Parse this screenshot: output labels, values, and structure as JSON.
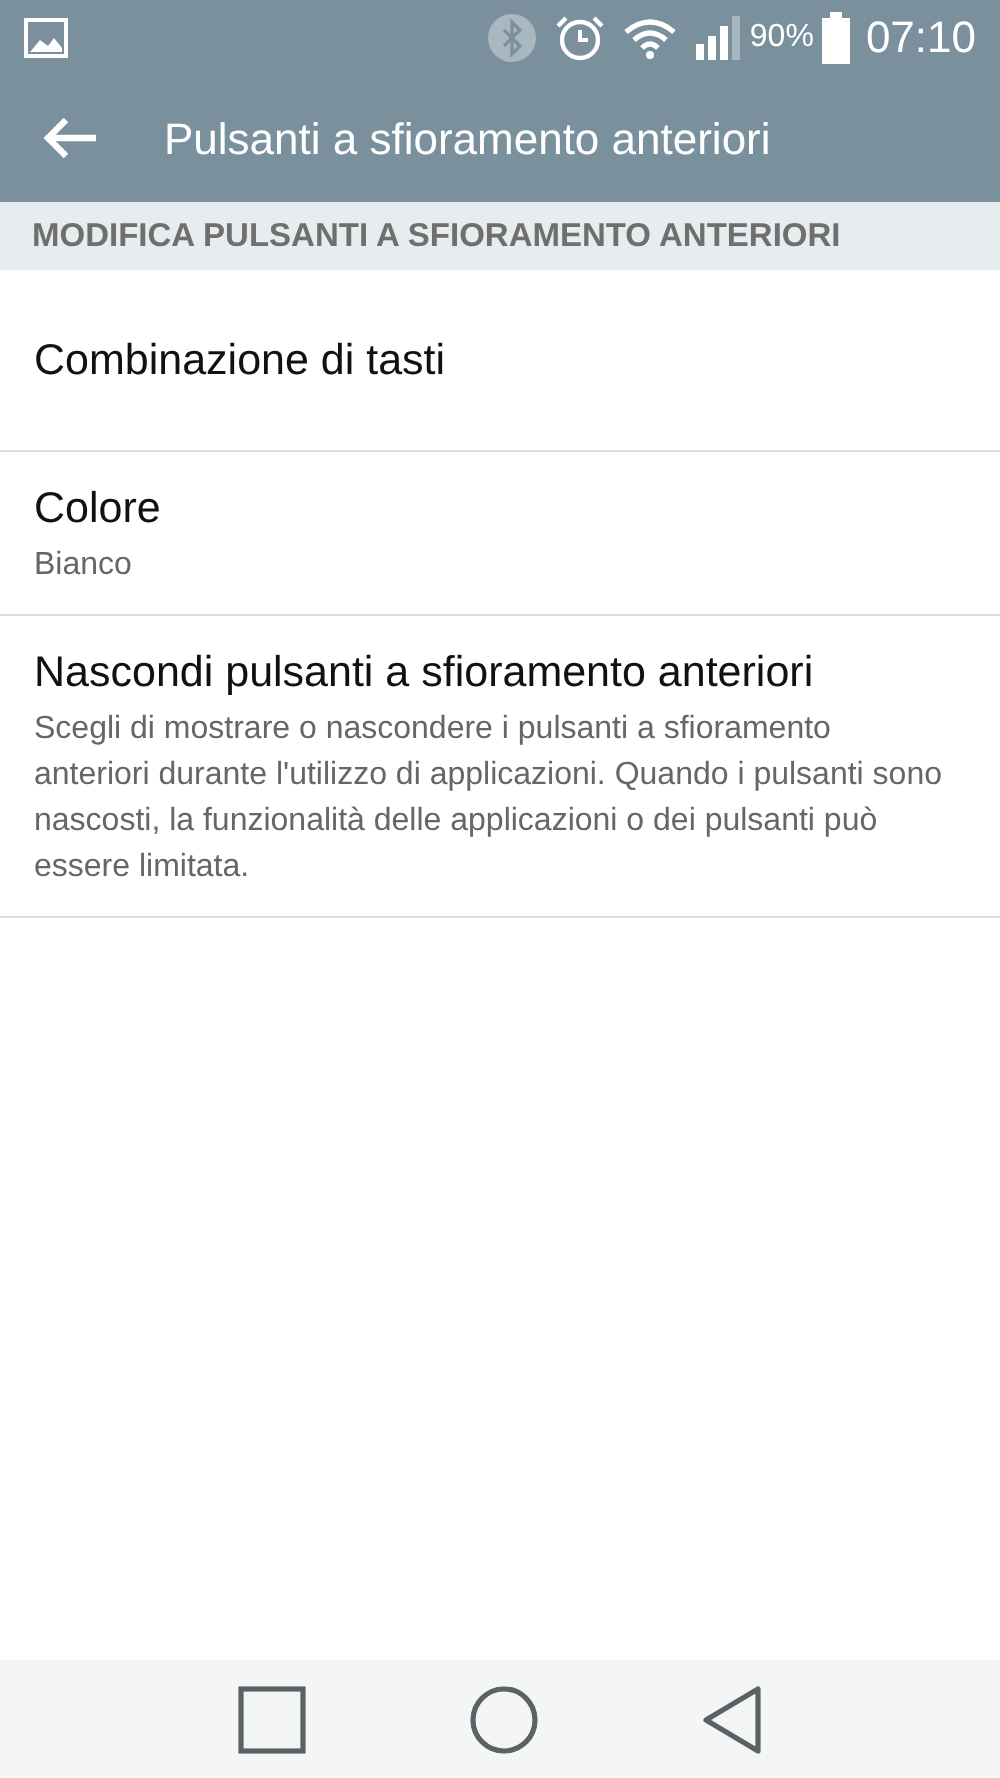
{
  "status_bar": {
    "battery": "90%",
    "time": "07:10"
  },
  "app_bar": {
    "title": "Pulsanti a sfioramento anteriori"
  },
  "section": {
    "header": "MODIFICA PULSANTI A SFIORAMENTO ANTERIORI"
  },
  "items": [
    {
      "title": "Combinazione di tasti"
    },
    {
      "title": "Colore",
      "summary": "Bianco"
    },
    {
      "title": "Nascondi pulsanti a sfioramento anteriori",
      "summary": "Scegli di mostrare o nascondere i pulsanti a sfioramento anteriori durante l'utilizzo di applicazioni. Quando i pulsanti sono nascosti, la funzionalità delle applicazioni o dei pulsanti può essere limitata."
    }
  ]
}
